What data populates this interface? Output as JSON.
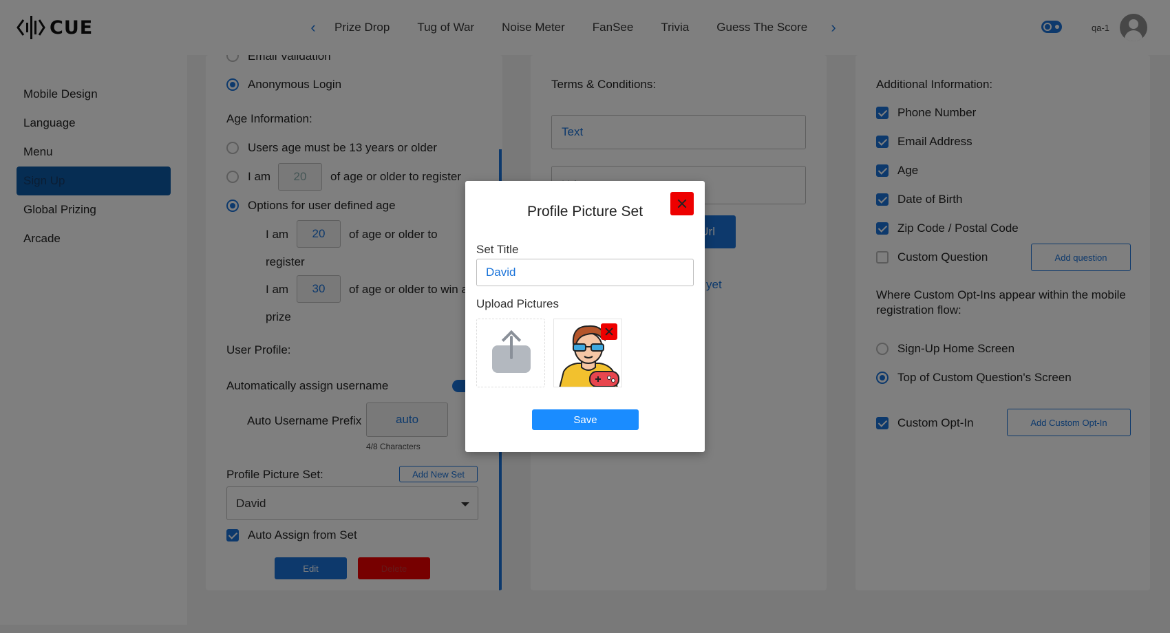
{
  "app": {
    "logo_text": "CUE",
    "user_name": "qa-1"
  },
  "nav": {
    "tabs": [
      "Prize Drop",
      "Tug of War",
      "Noise Meter",
      "FanSee",
      "Trivia",
      "Guess The Score"
    ]
  },
  "sidebar": {
    "items": [
      "Mobile Design",
      "Language",
      "Menu",
      "Sign Up",
      "Global Prizing",
      "Arcade"
    ],
    "active": "Sign Up"
  },
  "signup": {
    "email_validation": "Email Validation",
    "anonymous_login": "Anonymous Login",
    "age_information": "Age Information:",
    "age_13": "Users age must be 13 years or older",
    "i_am": "I am",
    "age_value_disabled": "20",
    "of_age_register": "of age or older to register",
    "options_user_defined": "Options for user defined age",
    "age_register_value": "20",
    "of_age_to": "of age or older to",
    "register": "register",
    "age_win_value": "30",
    "of_age_win": "of age or older to win a",
    "prize": "prize",
    "user_profile": "User Profile:",
    "auto_assign_username": "Automatically assign username",
    "auto_username_prefix": "Auto Username Prefix",
    "prefix_value": "auto",
    "prefix_chars": "4/8 Characters",
    "profile_picture_set": "Profile Picture Set:",
    "add_new_set": "Add New Set",
    "selected_set": "David",
    "auto_assign_from_set": "Auto Assign from Set",
    "edit": "Edit",
    "delete": "Delete"
  },
  "terms": {
    "label": "Terms & Conditions:",
    "text_placeholder": "Text",
    "url_placeholder": "Url",
    "save_url": "Url",
    "no_terms": "yet"
  },
  "additional": {
    "label": "Additional Information:",
    "fields": [
      {
        "label": "Phone Number",
        "checked": true
      },
      {
        "label": "Email Address",
        "checked": true
      },
      {
        "label": "Age",
        "checked": true
      },
      {
        "label": "Date of Birth",
        "checked": true
      },
      {
        "label": "Zip Code / Postal Code",
        "checked": true
      },
      {
        "label": "Custom Question",
        "checked": false
      }
    ],
    "add_question": "Add question",
    "where_opt_ins": "Where Custom Opt-Ins appear within the mobile registration flow:",
    "signup_home": "Sign-Up Home Screen",
    "top_custom_q": "Top of Custom Question's Screen",
    "custom_opt_in": "Custom Opt-In",
    "add_custom_opt_in": "Add Custom Opt-In"
  },
  "modal": {
    "title": "Profile Picture Set",
    "set_title_label": "Set Title",
    "set_title_value": "David",
    "upload_label": "Upload Pictures",
    "save": "Save"
  },
  "colors": {
    "accent": "#1a73d9",
    "danger": "#ee0000",
    "overlay": "rgba(0,0,0,0.5)"
  }
}
